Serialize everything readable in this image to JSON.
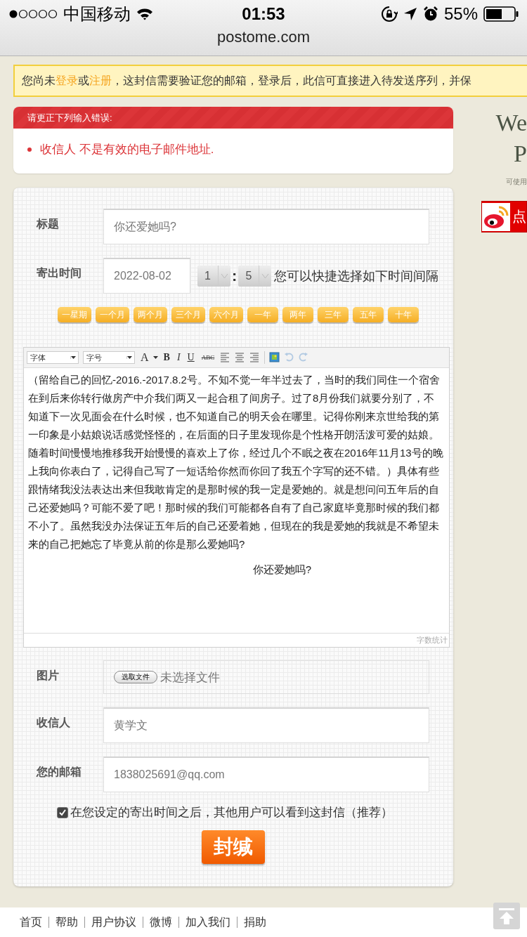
{
  "status_bar": {
    "carrier": "中国移动",
    "time": "01:53",
    "battery": "55%",
    "url": "postome.com"
  },
  "notice": {
    "parts": [
      {
        "kind": "text",
        "text": "您尚未"
      },
      {
        "kind": "link",
        "text": "登录"
      },
      {
        "kind": "text",
        "text": "或"
      },
      {
        "kind": "link",
        "text": "注册"
      },
      {
        "kind": "text",
        "text": "，这封信需要验证您的邮箱，登录后，此信可直接进入待发送序列，并保"
      }
    ]
  },
  "error": {
    "title": "请更正下列输入错误:",
    "items": [
      "收信人 不是有效的电子邮件地址."
    ]
  },
  "form": {
    "title_field": {
      "label": "标题",
      "value": "你还爱她吗?"
    },
    "send_time": {
      "label": "寄出时间",
      "date": "2022-08-02",
      "hour": "1",
      "separator": ":",
      "minute": "5",
      "hint": "您可以快捷选择如下时间间隔"
    },
    "quick_buttons": [
      "一星期",
      "一个月",
      "两个月",
      "三个月",
      "六个月",
      "一年",
      "两年",
      "三年",
      "五年",
      "十年"
    ],
    "editor": {
      "font_select": "字体",
      "size_select": "字号",
      "tools": [
        {
          "kind": "color",
          "label": "A",
          "disabled": false
        },
        {
          "kind": "bold",
          "label": "B",
          "disabled": false
        },
        {
          "kind": "italic",
          "label": "I",
          "disabled": false
        },
        {
          "kind": "underline",
          "label": "U",
          "disabled": false
        },
        {
          "kind": "strike",
          "label": "ABC",
          "disabled": false
        },
        {
          "kind": "align-left",
          "disabled": false
        },
        {
          "kind": "align-center",
          "disabled": false
        },
        {
          "kind": "align-right",
          "disabled": false
        },
        {
          "kind": "image",
          "disabled": false
        },
        {
          "kind": "undo",
          "disabled": true
        },
        {
          "kind": "redo",
          "disabled": true
        }
      ],
      "body": "（留给自己的回忆-2016.-2017.8.2号。不知不觉一年半过去了，当时的我们同住一个宿舍在到后来你转行做房产中介我们两又一起合租了间房子。过了8月份我们就要分别了，不知道下一次见面会在什么时候，也不知道自己的明天会在哪里。记得你刚来京世给我的第一印象是小姑娘说话感觉怪怪的，在后面的日子里发现你是个性格开朗活泼可爱的姑娘。随着时间慢慢地推移我开始慢慢的喜欢上了你，经过几个不眠之夜在2016年11月13号的晚上我向你表白了，记得自己写了一短话给你然而你回了我五个字写的还不错。）具体有些跟情绪我没法表达出来但我敢肯定的是那时候的我一定是爱她的。就是想问问五年后的自己还爱她吗？可能不爱了吧！那时候的我们可能都各自有了自己家庭毕竟那时候的我们都不小了。虽然我没办法保证五年后的自己还爱着她，但现在的我是爱她的我就是不希望未来的自己把她忘了毕竟从前的你是那么爱她吗?",
      "closing": "你还爱她吗?",
      "word_count": "字数统计"
    },
    "image_field": {
      "label": "图片",
      "button": "选取文件",
      "status": "未选择文件"
    },
    "recipient_field": {
      "label": "收信人",
      "value": "黄学文"
    },
    "email_field": {
      "label": "您的邮箱",
      "value": "1838025691@qq.com"
    },
    "public_option": {
      "label": "在您设定的寄出时间之后，其他用户可以看到这封信（推荐）",
      "checked": true
    },
    "submit": "封缄"
  },
  "side": {
    "heading_1": "We",
    "heading_2": "P",
    "note": "可使用",
    "weibo_button": "点"
  },
  "footer": {
    "links": [
      "首页",
      "帮助",
      "用户协议",
      "微博",
      "加入我们",
      "捐助"
    ]
  }
}
